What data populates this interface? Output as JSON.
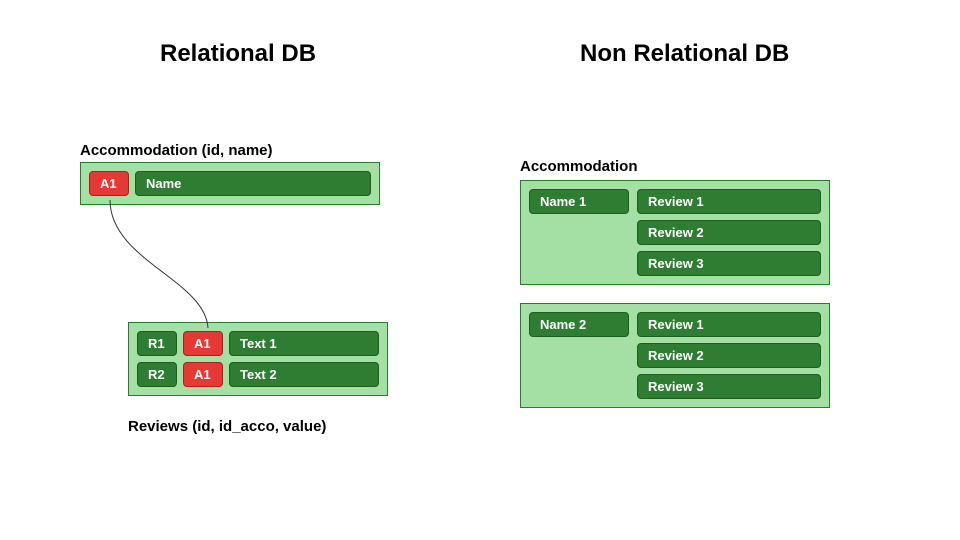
{
  "left": {
    "title": "Relational DB",
    "accommodation": {
      "label": "Accommodation (id, name)",
      "id": "A1",
      "name": "Name"
    },
    "reviews": {
      "label": "Reviews (id, id_acco, value)",
      "rows": [
        {
          "id": "R1",
          "acco": "A1",
          "text": "Text 1"
        },
        {
          "id": "R2",
          "acco": "A1",
          "text": "Text 2"
        }
      ]
    }
  },
  "right": {
    "title": "Non Relational DB",
    "label": "Accommodation",
    "docs": [
      {
        "name": "Name 1",
        "reviews": [
          "Review 1",
          "Review 2",
          "Review 3"
        ]
      },
      {
        "name": "Name 2",
        "reviews": [
          "Review 1",
          "Review 2",
          "Review 3"
        ]
      }
    ]
  },
  "colors": {
    "panel_bg": "#a4e0a4",
    "pill_green": "#2e7d32",
    "pill_red": "#e53935"
  }
}
